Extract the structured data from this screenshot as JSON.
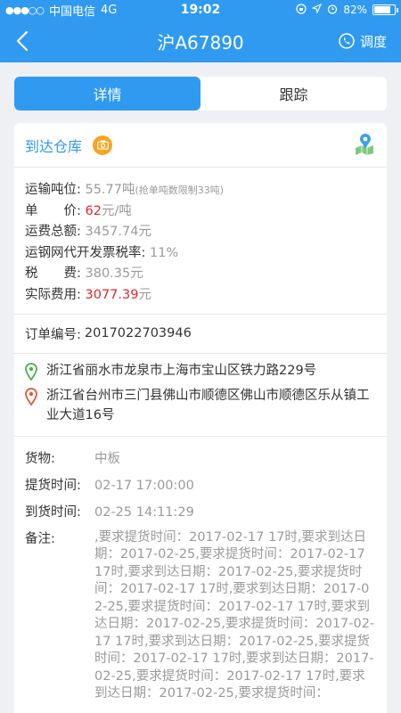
{
  "status_bar": {
    "carrier": "中国电信",
    "network": "4G",
    "time": "19:02",
    "battery": "82%",
    "battery_level": 0.82
  },
  "nav": {
    "title": "沪A67890",
    "dispatch_label": "调度"
  },
  "tabs": [
    {
      "label": "详情",
      "active": true
    },
    {
      "label": "跟踪",
      "active": false
    }
  ],
  "status": {
    "text": "到达仓库"
  },
  "fees": [
    {
      "label": "运输吨位:",
      "value": "55.77吨",
      "note": "(抢单吨数限制33吨)",
      "value_color": "gray"
    },
    {
      "label": "单　　价:",
      "value": "62",
      "unit": "元/吨",
      "value_color": "red"
    },
    {
      "label": "运费总额:",
      "value": "3457.74元",
      "value_color": "gray"
    },
    {
      "label": "运钢网代开发票税率:",
      "value": "11%",
      "value_color": "gray"
    },
    {
      "label": "税　　费:",
      "value": "380.35元",
      "value_color": "gray"
    },
    {
      "label": "实际费用:",
      "value": "3077.39",
      "unit": "元",
      "value_color": "red"
    }
  ],
  "order": {
    "label": "订单编号:",
    "number": "2017022703946"
  },
  "addresses": {
    "origin": "浙江省丽水市龙泉市上海市宝山区铁力路229号",
    "destination": "浙江省台州市三门县佛山市顺德区佛山市顺德区乐从镇工业大道16号"
  },
  "info": {
    "cargo_label": "货物:",
    "cargo_value": "中板",
    "pickup_label": "提货时间:",
    "pickup_value": "02-17 17:00:00",
    "arrival_label": "到货时间:",
    "arrival_value": "02-25 14:11:29",
    "remarks_label": "备注:",
    "remarks_value": ",要求提货时间：2017-02-17 17时,要求到达日期：2017-02-25,要求提货时间：2017-02-17 17时,要求到达日期：2017-02-25,要求提货时间：2017-02-17 17时,要求到达日期：2017-02-25,要求提货时间：2017-02-17 17时,要求到达日期：2017-02-25,要求提货时间：2017-02-17 17时,要求到达日期：2017-02-25,要求提货时间：2017-02-17 17时,要求到达日期：2017-02-25,要求提货时间：2017-02-17 17时,要求到达日期：2017-02-25,要求提货时间："
  },
  "colors": {
    "brand_blue": "#2f9af0",
    "price_red": "#e0282a",
    "muted_gray": "#9a9a9a",
    "camera_orange": "#f5a623"
  },
  "icons": [
    "signal-dots-icon",
    "alarm-icon",
    "location-arrow-icon",
    "lock-rotation-icon",
    "battery-icon",
    "back-chevron-icon",
    "phone-icon",
    "camera-icon",
    "map-pin-icon",
    "origin-pin-icon",
    "destination-pin-icon"
  ]
}
